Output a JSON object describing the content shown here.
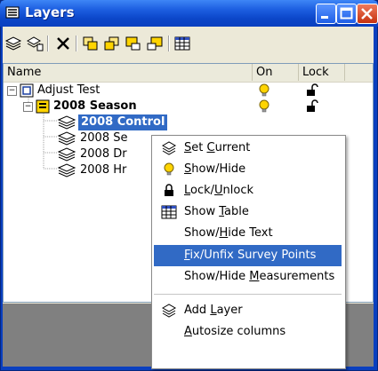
{
  "window": {
    "title": "Layers"
  },
  "columns": [
    "Name",
    "On",
    "Lock"
  ],
  "tree": [
    {
      "label": "Adjust Test",
      "bold": false
    },
    {
      "label": "2008 Season",
      "bold": true
    },
    {
      "label": "2008 Control",
      "bold": true
    },
    {
      "label": "2008 Se",
      "bold": false
    },
    {
      "label": "2008 Dr",
      "bold": false
    },
    {
      "label": "2008 Hr",
      "bold": false
    }
  ],
  "context_menu": {
    "items": [
      {
        "pre": "",
        "acc": "S",
        "post": "et ",
        "acc2": "C",
        "post2": "urrent"
      },
      {
        "pre": "",
        "acc": "S",
        "post": "how/Hide",
        "acc2": "",
        "post2": ""
      },
      {
        "pre": "",
        "acc": "L",
        "post": "ock/",
        "acc2": "U",
        "post2": "nlock"
      },
      {
        "pre": "Show ",
        "acc": "T",
        "post": "able",
        "acc2": "",
        "post2": ""
      },
      {
        "pre": "Show/",
        "acc": "H",
        "post": "ide Text",
        "acc2": "",
        "post2": ""
      },
      {
        "pre": "",
        "acc": "F",
        "post": "ix/Unfix Survey Points",
        "acc2": "",
        "post2": ""
      },
      {
        "pre": "Show/Hide ",
        "acc": "M",
        "post": "easurements",
        "acc2": "",
        "post2": ""
      },
      {
        "pre": "Add ",
        "acc": "L",
        "post": "ayer",
        "acc2": "",
        "post2": ""
      },
      {
        "pre": "",
        "acc": "A",
        "post": "utosize columns",
        "acc2": "",
        "post2": ""
      }
    ],
    "highlighted_index": 5
  },
  "colors": {
    "title_blue": "#0a3fbf",
    "selection": "#316ac5",
    "bulb": "#ffd400"
  },
  "icons": [
    "layers-icon",
    "minimize-icon",
    "maximize-icon",
    "close-icon",
    "bulb-icon",
    "lock-icon",
    "table-icon"
  ]
}
